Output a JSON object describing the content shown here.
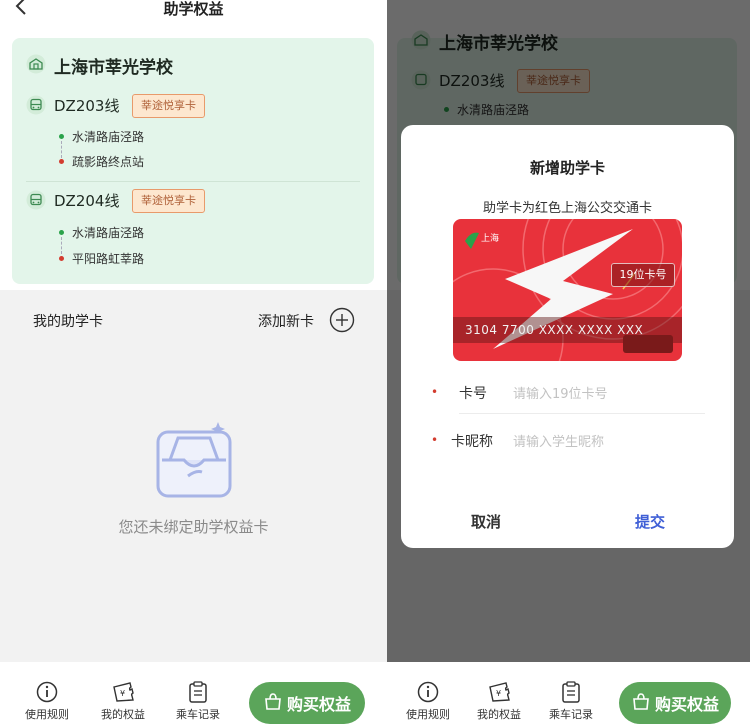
{
  "header": {
    "title": "助学权益"
  },
  "school": {
    "name": "上海市莘光学校"
  },
  "routes": [
    {
      "line": "DZ203线",
      "tag": "莘途悦享卡",
      "stops": [
        "水清路庙泾路",
        "疏影路终点站"
      ]
    },
    {
      "line": "DZ204线",
      "tag": "莘途悦享卡",
      "stops": [
        "水清路庙泾路",
        "平阳路虹莘路"
      ]
    }
  ],
  "my_cards": {
    "title": "我的助学卡",
    "add_label": "添加新卡",
    "empty_text": "您还未绑定助学权益卡"
  },
  "tabbar": {
    "rules": "使用规则",
    "rights": "我的权益",
    "records": "乘车记录",
    "buy": "购买权益"
  },
  "dialog": {
    "title": "新增助学卡",
    "subtitle": "助学卡为红色上海公交交通卡",
    "card_hint": "19位卡号",
    "card_number_sample": "3104 7700 XXXX XXXX XXX",
    "card_brand": "上海",
    "fields": [
      {
        "label": "卡号",
        "placeholder": "请输入19位卡号"
      },
      {
        "label": "卡昵称",
        "placeholder": "请输入学生昵称"
      }
    ],
    "cancel": "取消",
    "submit": "提交"
  },
  "colors": {
    "accent_green": "#5ba55a",
    "card_bg": "#e3f5ea",
    "tag_text": "#b0623a",
    "submit_blue": "#3f5fd6",
    "transit_card_red": "#e8323b"
  },
  "icons": [
    "back-icon",
    "school-icon",
    "bus-icon",
    "plus-circle-icon",
    "empty-box-icon",
    "info-icon",
    "ticket-icon",
    "clipboard-icon",
    "bag-icon"
  ]
}
